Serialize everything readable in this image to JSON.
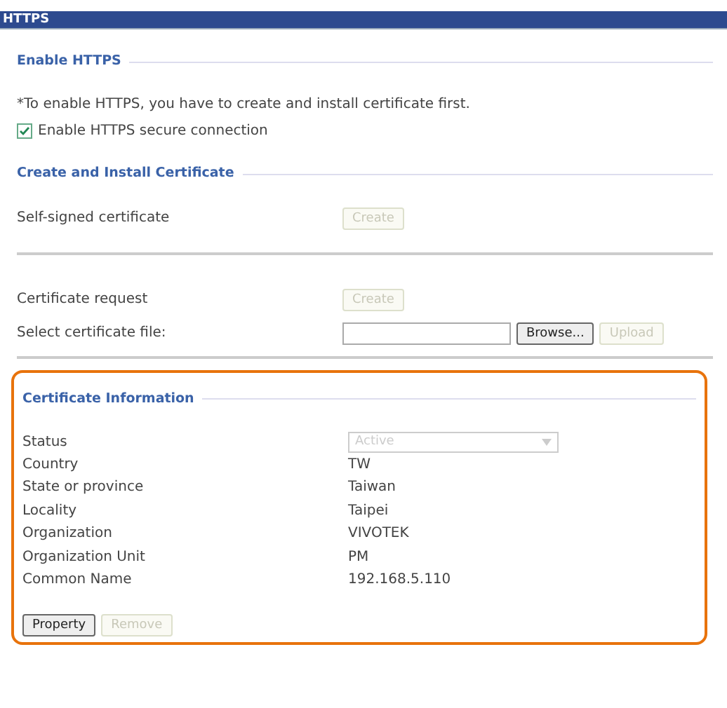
{
  "title": "HTTPS",
  "enable_section": {
    "legend": "Enable HTTPS",
    "note": "*To enable HTTPS, you have to create and install certificate first.",
    "checkbox": {
      "label": "Enable HTTPS secure connection",
      "checked": true
    }
  },
  "create_section": {
    "legend": "Create and Install Certificate",
    "rows": [
      {
        "label": "Self-signed certificate",
        "button": {
          "label": "Create",
          "disabled": true
        }
      },
      {
        "label": "Certificate request",
        "button": {
          "label": "Create",
          "disabled": true
        }
      },
      {
        "label": "Select certificate file:",
        "browse": {
          "label": "Browse...",
          "disabled": false
        },
        "button": {
          "label": "Upload",
          "disabled": true
        }
      }
    ]
  },
  "info_section": {
    "legend": "Certificate Information",
    "highlighted": true,
    "status": {
      "label": "Status",
      "value": "Active",
      "disabled": true
    },
    "fields": [
      {
        "label": "Country",
        "value": "TW"
      },
      {
        "label": "State or province",
        "value": "Taiwan"
      },
      {
        "label": "Locality",
        "value": "Taipei"
      },
      {
        "label": "Organization",
        "value": "VIVOTEK"
      },
      {
        "label": "Organization Unit",
        "value": "PM"
      },
      {
        "label": "Common Name",
        "value": "192.168.5.110"
      }
    ],
    "buttons": [
      {
        "label": "Property",
        "disabled": false
      },
      {
        "label": "Remove",
        "disabled": true
      }
    ]
  }
}
